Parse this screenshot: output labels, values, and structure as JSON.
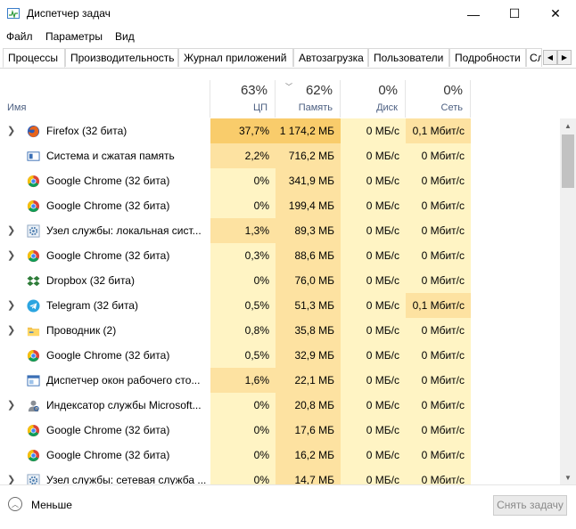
{
  "window": {
    "title": "Диспетчер задач",
    "minimize_glyph": "—",
    "maximize_glyph": "☐",
    "close_glyph": "✕"
  },
  "menu": [
    "Файл",
    "Параметры",
    "Вид"
  ],
  "tabs": [
    "Процессы",
    "Производительность",
    "Журнал приложений",
    "Автозагрузка",
    "Пользователи",
    "Подробности",
    "Службы"
  ],
  "active_tab": "Процессы",
  "columns": {
    "name": {
      "label": "Имя"
    },
    "cpu": {
      "percent": "63%",
      "label": "ЦП"
    },
    "memory": {
      "percent": "62%",
      "label": "Память",
      "sorted": true
    },
    "disk": {
      "percent": "0%",
      "label": "Диск"
    },
    "network": {
      "percent": "0%",
      "label": "Сеть"
    }
  },
  "heat_colors": {
    "strong": "#f9cc6b",
    "medium": "#fde2a1",
    "light": "#fff4c4"
  },
  "processes": [
    {
      "name": "Firefox (32 бита)",
      "icon": "firefox-icon",
      "expandable": true,
      "cpu": "37,7%",
      "memory": "1 174,2 МБ",
      "disk": "0 МБ/с",
      "network": "0,1 Мбит/с",
      "cpu_heat": "strong",
      "mem_heat": "strong",
      "net_heat": "medium"
    },
    {
      "name": "Система и сжатая память",
      "icon": "system-icon",
      "expandable": false,
      "cpu": "2,2%",
      "memory": "716,2 МБ",
      "disk": "0 МБ/с",
      "network": "0 Мбит/с",
      "cpu_heat": "medium",
      "mem_heat": "medium",
      "net_heat": "light"
    },
    {
      "name": "Google Chrome (32 бита)",
      "icon": "chrome-icon",
      "expandable": false,
      "cpu": "0%",
      "memory": "341,9 МБ",
      "disk": "0 МБ/с",
      "network": "0 Мбит/с",
      "cpu_heat": "light",
      "mem_heat": "medium",
      "net_heat": "light"
    },
    {
      "name": "Google Chrome (32 бита)",
      "icon": "chrome-icon",
      "expandable": false,
      "cpu": "0%",
      "memory": "199,4 МБ",
      "disk": "0 МБ/с",
      "network": "0 Мбит/с",
      "cpu_heat": "light",
      "mem_heat": "medium",
      "net_heat": "light"
    },
    {
      "name": "Узел службы: локальная сист...",
      "icon": "gear-icon",
      "expandable": true,
      "cpu": "1,3%",
      "memory": "89,3 МБ",
      "disk": "0 МБ/с",
      "network": "0 Мбит/с",
      "cpu_heat": "medium",
      "mem_heat": "medium",
      "net_heat": "light"
    },
    {
      "name": "Google Chrome (32 бита)",
      "icon": "chrome-icon",
      "expandable": true,
      "cpu": "0,3%",
      "memory": "88,6 МБ",
      "disk": "0 МБ/с",
      "network": "0 Мбит/с",
      "cpu_heat": "light",
      "mem_heat": "medium",
      "net_heat": "light"
    },
    {
      "name": "Dropbox (32 бита)",
      "icon": "dropbox-icon",
      "expandable": false,
      "cpu": "0%",
      "memory": "76,0 МБ",
      "disk": "0 МБ/с",
      "network": "0 Мбит/с",
      "cpu_heat": "light",
      "mem_heat": "medium",
      "net_heat": "light"
    },
    {
      "name": "Telegram (32 бита)",
      "icon": "telegram-icon",
      "expandable": true,
      "cpu": "0,5%",
      "memory": "51,3 МБ",
      "disk": "0 МБ/с",
      "network": "0,1 Мбит/с",
      "cpu_heat": "light",
      "mem_heat": "medium",
      "net_heat": "medium"
    },
    {
      "name": "Проводник (2)",
      "icon": "folder-icon",
      "expandable": true,
      "cpu": "0,8%",
      "memory": "35,8 МБ",
      "disk": "0 МБ/с",
      "network": "0 Мбит/с",
      "cpu_heat": "light",
      "mem_heat": "medium",
      "net_heat": "light"
    },
    {
      "name": "Google Chrome (32 бита)",
      "icon": "chrome-icon",
      "expandable": false,
      "cpu": "0,5%",
      "memory": "32,9 МБ",
      "disk": "0 МБ/с",
      "network": "0 Мбит/с",
      "cpu_heat": "light",
      "mem_heat": "medium",
      "net_heat": "light"
    },
    {
      "name": "Диспетчер окон рабочего сто...",
      "icon": "window-manager-icon",
      "expandable": false,
      "cpu": "1,6%",
      "memory": "22,1 МБ",
      "disk": "0 МБ/с",
      "network": "0 Мбит/с",
      "cpu_heat": "medium",
      "mem_heat": "medium",
      "net_heat": "light"
    },
    {
      "name": "Индексатор службы Microsoft...",
      "icon": "indexer-icon",
      "expandable": true,
      "cpu": "0%",
      "memory": "20,8 МБ",
      "disk": "0 МБ/с",
      "network": "0 Мбит/с",
      "cpu_heat": "light",
      "mem_heat": "medium",
      "net_heat": "light"
    },
    {
      "name": "Google Chrome (32 бита)",
      "icon": "chrome-icon",
      "expandable": false,
      "cpu": "0%",
      "memory": "17,6 МБ",
      "disk": "0 МБ/с",
      "network": "0 Мбит/с",
      "cpu_heat": "light",
      "mem_heat": "medium",
      "net_heat": "light"
    },
    {
      "name": "Google Chrome (32 бита)",
      "icon": "chrome-icon",
      "expandable": false,
      "cpu": "0%",
      "memory": "16,2 МБ",
      "disk": "0 МБ/с",
      "network": "0 Мбит/с",
      "cpu_heat": "light",
      "mem_heat": "medium",
      "net_heat": "light"
    },
    {
      "name": "Узел службы: сетевая служба ...",
      "icon": "gear-icon",
      "expandable": true,
      "cpu": "0%",
      "memory": "14,7 МБ",
      "disk": "0 МБ/с",
      "network": "0 Мбит/с",
      "cpu_heat": "light",
      "mem_heat": "medium",
      "net_heat": "light"
    }
  ],
  "footer": {
    "less_label": "Меньше",
    "end_task_label": "Снять задачу"
  }
}
